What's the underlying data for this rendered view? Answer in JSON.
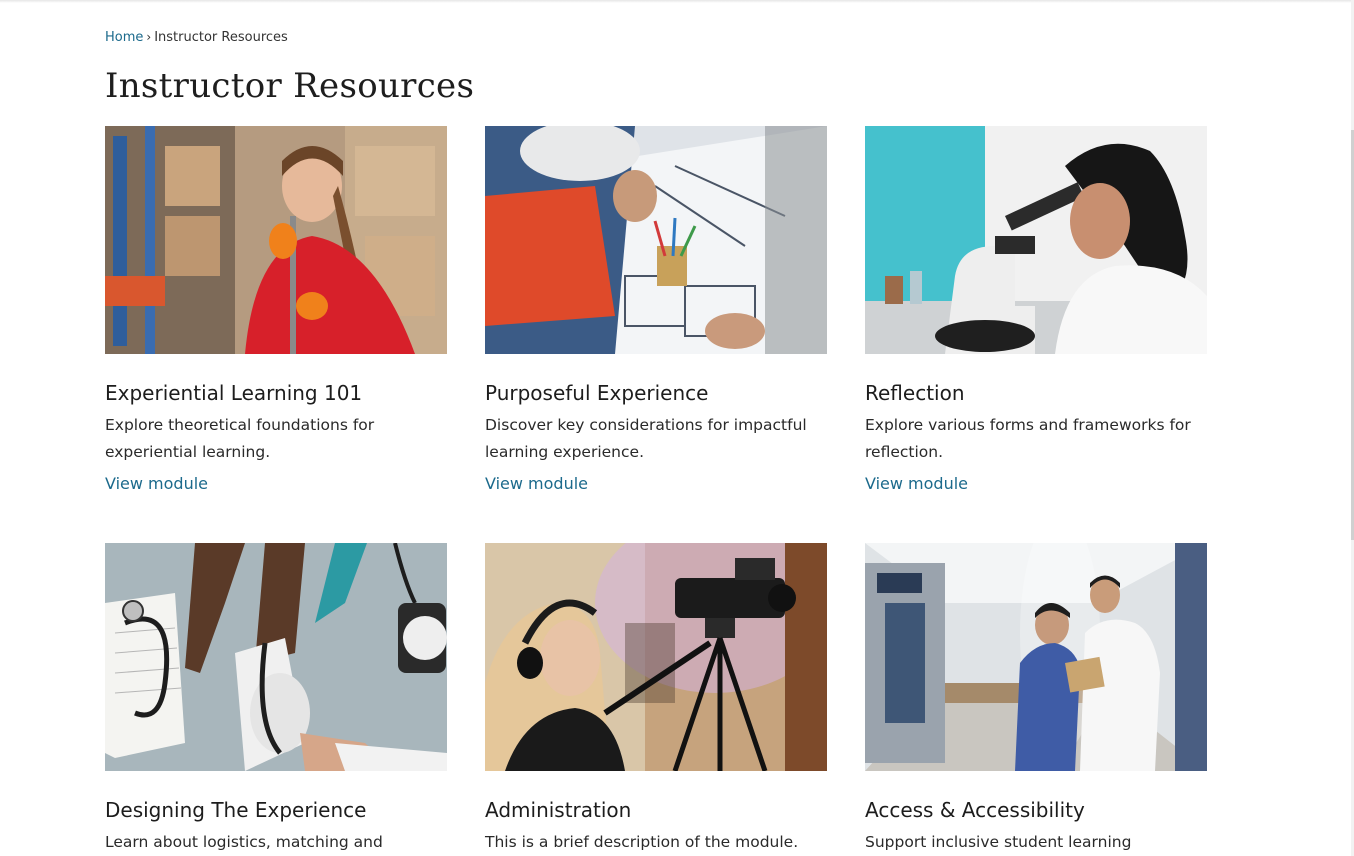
{
  "breadcrumb": {
    "home": "Home",
    "separator": "›",
    "current": "Instructor Resources"
  },
  "page": {
    "title": "Instructor Resources"
  },
  "colors": {
    "link": "#1c6a8c",
    "text": "#222222",
    "background": "#ffffff"
  },
  "cards": [
    {
      "title": "Experiential Learning 101",
      "description": "Explore theoretical foundations for experiential learning.",
      "link": "View module",
      "image": "warehouse-worker-photo"
    },
    {
      "title": "Purposeful Experience",
      "description": "Discover key considerations for impactful learning experience.",
      "link": "View module",
      "image": "architect-blueprints-photo"
    },
    {
      "title": "Reflection",
      "description": "Explore various forms and frameworks for reflection.",
      "link": "View module",
      "image": "lab-microscope-photo"
    },
    {
      "title": "Designing The Experience",
      "description": "Learn about logistics, matching and",
      "image": "blood-pressure-photo"
    },
    {
      "title": "Administration",
      "description": "This is a brief description of the module.",
      "image": "video-camera-photo"
    },
    {
      "title": "Access & Accessibility",
      "description": "Support inclusive student learning",
      "image": "hospital-hallway-photo"
    }
  ]
}
